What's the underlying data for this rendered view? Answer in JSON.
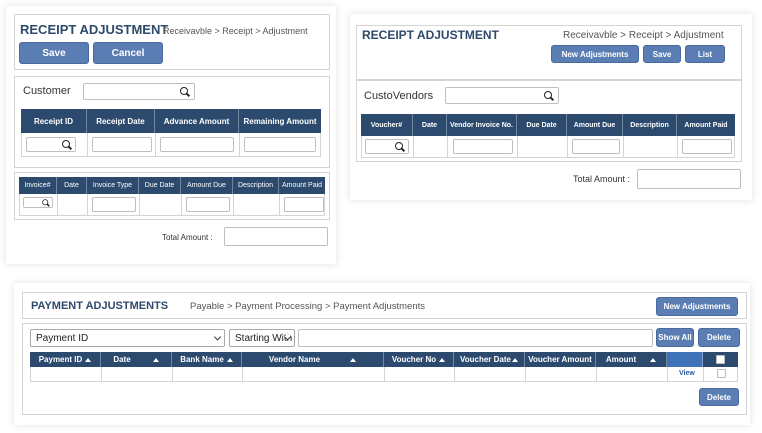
{
  "panel1": {
    "title": "RECEIPT ADJUSTMENT",
    "breadcrumb": "Receivavble > Receipt > Adjustment",
    "save_label": "Save",
    "cancel_label": "Cancel",
    "customer_label": "Customer",
    "table1_headers": [
      "Receipt ID",
      "Receipt Date",
      "Advance Amount",
      "Remaining Amount"
    ],
    "table2_headers": [
      "Invoice#",
      "Date",
      "Invoice Type",
      "Due Date",
      "Amount Due",
      "Description",
      "Amount Paid"
    ],
    "total_label": "Total Amount :"
  },
  "panel2": {
    "title": "RECEIPT ADJUSTMENT",
    "breadcrumb": "Receivavble > Receipt > Adjustment",
    "new_label": "New Adjustments",
    "save_label": "Save",
    "list_label": "List",
    "vendor_label": "CustoVendors",
    "table_headers": [
      "Voucher#",
      "Date",
      "Vendor Invoice No.",
      "Due Date",
      "Amount Due",
      "Description",
      "Amount Paid"
    ],
    "total_label": "Total Amount :"
  },
  "panel3": {
    "title": "PAYMENT ADJUSTMENTS",
    "breadcrumb": "Payable > Payment Processing > Payment Adjustments",
    "new_label": "New Adjustments",
    "filter_field": "Payment ID",
    "filter_op": "Starting With",
    "show_all_label": "Show All",
    "delete_label": "Delete",
    "table_headers": [
      "Payment ID",
      "Date",
      "Bank Name",
      "Vendor Name",
      "Voucher No",
      "Voucher Date",
      "Voucher Amount",
      "Amount"
    ],
    "view_label": "View",
    "bottom_delete_label": "Delete"
  },
  "icons": {
    "search": "search-icon",
    "sort": "sort-asc-icon",
    "dropdown": "chevron-down-icon",
    "checkbox": "checkbox-icon"
  },
  "colors": {
    "header_bg": "#2c4a6e",
    "button_bg": "#5a7db3",
    "title": "#2e4a6b"
  }
}
